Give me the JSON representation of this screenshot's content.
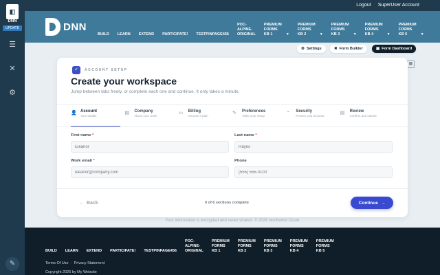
{
  "persona": {
    "logo_text": "DNN",
    "update_label": "UPDATE"
  },
  "topbar": {
    "logout": "Logout",
    "user": "SuperUser Account"
  },
  "header": {
    "brand": "DNN",
    "nav": [
      {
        "label": "BUILD"
      },
      {
        "label": "LEARN"
      },
      {
        "label": "EXTEND"
      },
      {
        "label": "PARTICIPATE!"
      },
      {
        "label": "TESTPINPAGE456"
      },
      {
        "lines": [
          "POC-",
          "ALPINE-",
          "ORIGINAL"
        ]
      },
      {
        "lines": [
          "PREMIUM",
          "FORMS",
          "KB 1"
        ],
        "caret": true
      },
      {
        "lines": [
          "PREMIUM",
          "FORMS",
          "KB 2"
        ],
        "caret": true
      },
      {
        "lines": [
          "PREMIUM",
          "FORMS",
          "KB 3"
        ],
        "caret": true
      },
      {
        "lines": [
          "PREMIUM",
          "FORMS",
          "KB 4"
        ],
        "caret": true
      },
      {
        "lines": [
          "PREMIUM",
          "FORMS",
          "KB 5"
        ],
        "caret": true
      }
    ]
  },
  "subbar": {
    "settings": "Settings",
    "form_builder": "Form Builder",
    "form_dashboard": "Form Dashboard"
  },
  "card": {
    "eyebrow": "ACCOUNT SETUP",
    "title": "Create your workspace",
    "subtitle": "Jump between tabs freely, or complete each one and continue. It only takes a minute.",
    "steps": [
      {
        "title": "Account",
        "sub": "Your details",
        "active": true
      },
      {
        "title": "Company",
        "sub": "About your work"
      },
      {
        "title": "Billing",
        "sub": "Choose a plan"
      },
      {
        "title": "Preferences",
        "sub": "Tailor your setup"
      },
      {
        "title": "Security",
        "sub": "Protect your account"
      },
      {
        "title": "Review",
        "sub": "Confirm and submit"
      }
    ],
    "fields": {
      "first_name": {
        "label": "First name",
        "placeholder": "Eleanor",
        "required": true
      },
      "last_name": {
        "label": "Last name",
        "placeholder": "Hayes",
        "required": true
      },
      "work_email": {
        "label": "Work email",
        "placeholder": "eleanor@company.com",
        "required": true
      },
      "phone": {
        "label": "Phone",
        "placeholder": "(555) 555-0100",
        "required": false
      }
    },
    "back": "Back",
    "progress": "0 of 6 sections complete",
    "continue": "Continue"
  },
  "fineprint": "Your information is encrypted and never shared. © 2026 Northwind Cloud",
  "footer": {
    "nav": [
      {
        "label": "BUILD"
      },
      {
        "label": "LEARN"
      },
      {
        "label": "EXTEND"
      },
      {
        "label": "PARTICIPATE!"
      },
      {
        "label": "TESTPINPAGE456"
      },
      {
        "lines": [
          "POC-",
          "ALPINE-",
          "ORIGINAL"
        ]
      },
      {
        "lines": [
          "PREMIUM",
          "FORMS",
          "KB 1"
        ]
      },
      {
        "lines": [
          "PREMIUM",
          "FORMS",
          "KB 2"
        ]
      },
      {
        "lines": [
          "PREMIUM",
          "FORMS",
          "KB 3"
        ]
      },
      {
        "lines": [
          "PREMIUM",
          "FORMS",
          "KB 4"
        ]
      },
      {
        "lines": [
          "PREMIUM",
          "FORMS",
          "KB 5"
        ]
      }
    ],
    "terms": "Terms Of Use",
    "privacy": "Privacy Statement",
    "copyright": "Copyright 2026 by My Website"
  },
  "colors": {
    "header_bg": "#3f7a9a",
    "persona_bg": "#1f3a4d",
    "footer_bg": "#0f1e29",
    "accent": "#3a4ad0"
  }
}
